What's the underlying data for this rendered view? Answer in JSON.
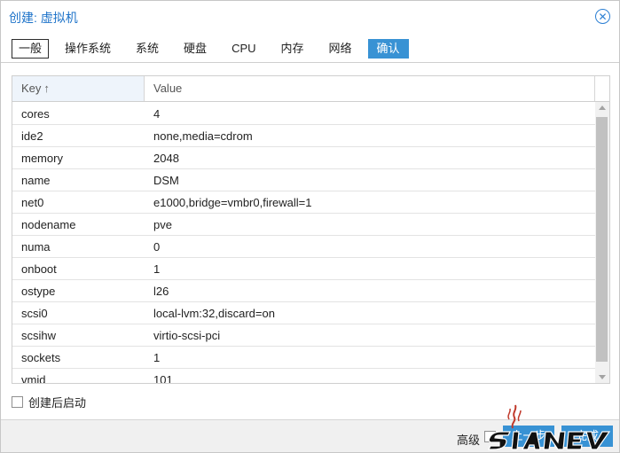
{
  "window": {
    "title": "创建: 虚拟机",
    "close_icon": "close-circle-icon"
  },
  "tabs": [
    {
      "label": "一般",
      "state": "active"
    },
    {
      "label": "操作系统"
    },
    {
      "label": "系统"
    },
    {
      "label": "硬盘"
    },
    {
      "label": "CPU"
    },
    {
      "label": "内存"
    },
    {
      "label": "网络"
    },
    {
      "label": "确认",
      "state": "highlighted"
    }
  ],
  "grid": {
    "key_header": "Key",
    "value_header": "Value",
    "sort_indicator": "↑",
    "rows": [
      {
        "key": "cores",
        "value": "4"
      },
      {
        "key": "ide2",
        "value": "none,media=cdrom"
      },
      {
        "key": "memory",
        "value": "2048"
      },
      {
        "key": "name",
        "value": "DSM"
      },
      {
        "key": "net0",
        "value": "e1000,bridge=vmbr0,firewall=1"
      },
      {
        "key": "nodename",
        "value": "pve"
      },
      {
        "key": "numa",
        "value": "0"
      },
      {
        "key": "onboot",
        "value": "1"
      },
      {
        "key": "ostype",
        "value": "l26"
      },
      {
        "key": "scsi0",
        "value": "local-lvm:32,discard=on"
      },
      {
        "key": "scsihw",
        "value": "virtio-scsi-pci"
      },
      {
        "key": "sockets",
        "value": "1"
      },
      {
        "key": "vmid",
        "value": "101"
      }
    ]
  },
  "start_after_created": {
    "label": "创建后启动",
    "checked": false
  },
  "footer": {
    "advanced_label": "高级",
    "advanced_checked": false,
    "back_label": "上一步",
    "finish_label": "完成"
  },
  "colors": {
    "accent": "#3892d4",
    "title": "#1e73c9",
    "header_bg": "#eef4fb"
  }
}
